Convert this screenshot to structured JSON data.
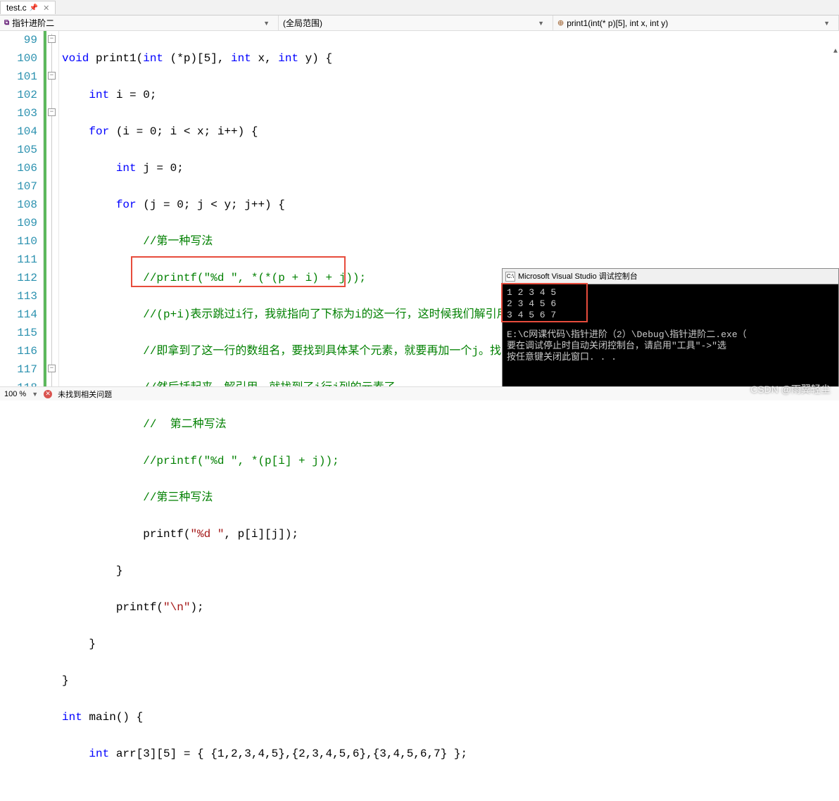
{
  "tab": {
    "filename": "test.c"
  },
  "nav": {
    "project": "指针进阶二",
    "scope": "(全局范围)",
    "func": "print1(int(* p)[5], int x, int y)"
  },
  "lines": {
    "start": 99,
    "end": 118
  },
  "code": {
    "l99_pre": "void",
    "l99_fn": " print1(",
    "l99_int": "int",
    "l99_mid": " (*p)[5], ",
    "l99_int2": "int",
    "l99_x": " x, ",
    "l99_int3": "int",
    "l99_end": " y) {",
    "l100_int": "int",
    "l100_rest": " i = 0;",
    "l101_for": "for",
    "l101_rest": " (i = 0; i < x; i++) {",
    "l102_int": "int",
    "l102_rest": " j = 0;",
    "l103_for": "for",
    "l103_rest": " (j = 0; j < y; j++) {",
    "l104": "//第一种写法",
    "l105": "//printf(\"%d \", *(*(p + i) + j));",
    "l106": "//(p+i)表示跳过i行，我就指向了下标为i的这一行，这时候我们解引用，就找到了这一行，即：*（p+i）",
    "l107": "//即拿到了这一行的数组名，要找到具体某个元素，就要再加一个j。找到下标为j的这个元素的地址。",
    "l108": "//然后括起来，解引用，就找到了i行j列的元素了。",
    "l109": "//  第二种写法",
    "l110": "//printf(\"%d \", *(p[i] + j));",
    "l111": "//第三种写法",
    "l112_a": "printf(",
    "l112_str": "\"%d \"",
    "l112_b": ", p[i][j]);",
    "l113": "}",
    "l114_a": "printf(",
    "l114_str": "\"\\n\"",
    "l114_b": ");",
    "l115": "}",
    "l116": "}",
    "l117_int": "int",
    "l117_rest": " main() {",
    "l118_int": "int",
    "l118_rest": " arr[3][5] = { {1,2,3,4,5},{2,3,4,5,6},{3,4,5,6,7} };"
  },
  "console": {
    "title": "Microsoft Visual Studio 调试控制台",
    "row1": "1 2 3 4 5",
    "row2": "2 3 4 5 6",
    "row3": "3 4 5 6 7",
    "path": "E:\\C网课代码\\指针进阶（2）\\Debug\\指针进阶二.exe（",
    "msg1": "要在调试停止时自动关闭控制台，请启用\"工具\"->\"选",
    "msg2": "按任意键关闭此窗口. . ."
  },
  "status": {
    "zoom": "100 %",
    "errmsg": "未找到相关问题"
  },
  "watermark": "CSDN @雨翼轻尘"
}
